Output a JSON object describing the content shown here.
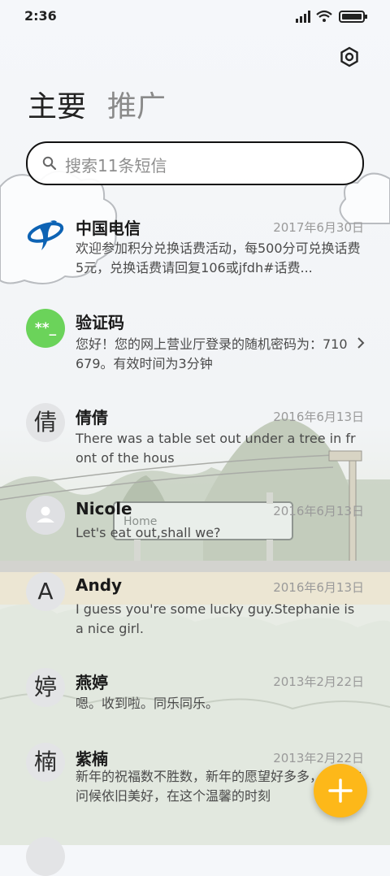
{
  "status_bar": {
    "time": "2:36"
  },
  "tabs": [
    {
      "label": "主要"
    },
    {
      "label": "推广"
    }
  ],
  "search": {
    "placeholder": "搜索11条短信"
  },
  "conversations": [
    {
      "avatar": "",
      "sender": "中国电信",
      "date": "2017年6月30日",
      "preview": "欢迎参加积分兑换话费活动，每500分可兑换话费5元，兑换话费请回复106或jfdh#话费..."
    },
    {
      "avatar": "**_",
      "sender": "验证码",
      "date": "",
      "preview": "您好！您的网上营业厅登录的随机密码为：710679。有效时间为3分钟"
    },
    {
      "avatar": "倩",
      "sender": "倩倩",
      "date": "2016年6月13日",
      "preview": "There was a table set out under a tree in front of the hous"
    },
    {
      "avatar": "",
      "sender": "Nicole",
      "date": "2016年6月13日",
      "preview": "Let's eat out,shall we?"
    },
    {
      "avatar": "A",
      "sender": "Andy",
      "date": "2016年6月13日",
      "preview": "I guess you're some lucky guy.Stephanie is a nice girl."
    },
    {
      "avatar": "婷",
      "sender": "燕婷",
      "date": "2013年2月22日",
      "preview": "嗯。收到啦。同乐同乐。"
    },
    {
      "avatar": "楠",
      "sender": "紫楠",
      "date": "2013年2月22日",
      "preview": "新年的祝福数不胜数，新年的愿望好多多，新年的问候依旧美好，在这个温馨的时刻"
    }
  ],
  "background_sign_text": "Home",
  "colors": {
    "accent_fab": "#fdb819",
    "verify_avatar": "#6bd35a",
    "telecom_blue": "#0d63b4"
  },
  "icons": {
    "settings": "gear-icon",
    "search": "search-icon",
    "chevron": "chevron-right-icon",
    "fab": "plus-icon",
    "contact": "person-icon",
    "telecom": "china-telecom-logo"
  }
}
